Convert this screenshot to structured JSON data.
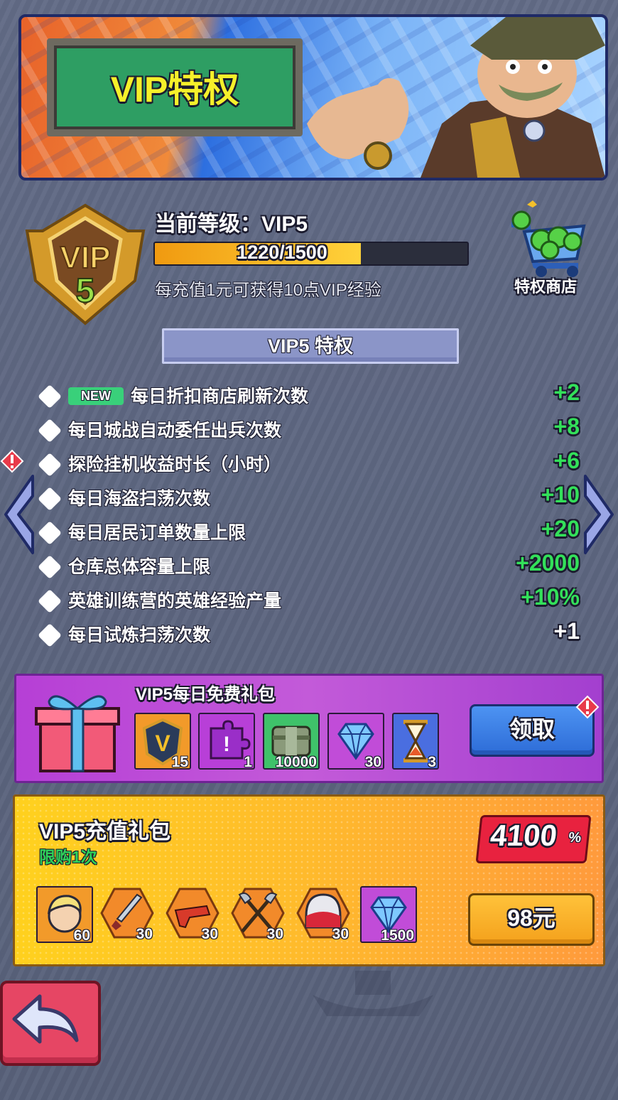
{
  "banner": {
    "title": "VIP特权"
  },
  "level": {
    "title": "当前等级：VIP5",
    "badge_top": "VIP",
    "badge_level": "5",
    "xp_current": 1220,
    "xp_max": 1500,
    "xp_text": "1220/1500",
    "note": "每充值1元可获得10点VIP经验"
  },
  "shop": {
    "label": "特权商店"
  },
  "privileges": {
    "header": "VIP5 特权",
    "new_label": "NEW",
    "items": [
      {
        "label": "每日折扣商店刷新次数",
        "value": "+2",
        "is_new": true,
        "color": "#33e05a"
      },
      {
        "label": "每日城战自动委任出兵次数",
        "value": "+8",
        "is_new": false,
        "color": "#33e05a"
      },
      {
        "label": "探险挂机收益时长（小时）",
        "value": "+6",
        "is_new": false,
        "color": "#33e05a"
      },
      {
        "label": "每日海盗扫荡次数",
        "value": "+10",
        "is_new": false,
        "color": "#33e05a"
      },
      {
        "label": "每日居民订单数量上限",
        "value": "+20",
        "is_new": false,
        "color": "#33e05a"
      },
      {
        "label": "仓库总体容量上限",
        "value": "+2000",
        "is_new": false,
        "color": "#33e05a"
      },
      {
        "label": "英雄训练营的英雄经验产量",
        "value": "+10%",
        "is_new": false,
        "color": "#33e05a"
      },
      {
        "label": "每日试炼扫荡次数",
        "value": "+1",
        "is_new": false,
        "color": "#ffffff"
      }
    ]
  },
  "daily_pack": {
    "title": "VIP5每日免费礼包",
    "claim_label": "领取",
    "items": [
      {
        "icon": "vip-exp-icon",
        "qty": "15"
      },
      {
        "icon": "puzzle-piece-icon",
        "qty": "1"
      },
      {
        "icon": "cash-stack-icon",
        "qty": "10000"
      },
      {
        "icon": "diamond-icon",
        "qty": "30"
      },
      {
        "icon": "hourglass-icon",
        "qty": "3"
      }
    ]
  },
  "recharge_pack": {
    "title": "VIP5充值礼包",
    "limit": "限购1次",
    "value": "4100",
    "value_unit": "%",
    "price": "98元",
    "items": [
      {
        "icon": "hero-portrait-icon",
        "qty": "60"
      },
      {
        "icon": "dagger-icon",
        "qty": "30"
      },
      {
        "icon": "blaster-gun-icon",
        "qty": "30"
      },
      {
        "icon": "crossed-axes-icon",
        "qty": "30"
      },
      {
        "icon": "helmet-icon",
        "qty": "30"
      },
      {
        "icon": "diamond-icon",
        "qty": "1500"
      }
    ]
  },
  "colors": {
    "accent_green": "#33e05a",
    "claim_blue": "#2d6cd7",
    "price_orange": "#f4a11c",
    "back_red": "#e64664"
  }
}
